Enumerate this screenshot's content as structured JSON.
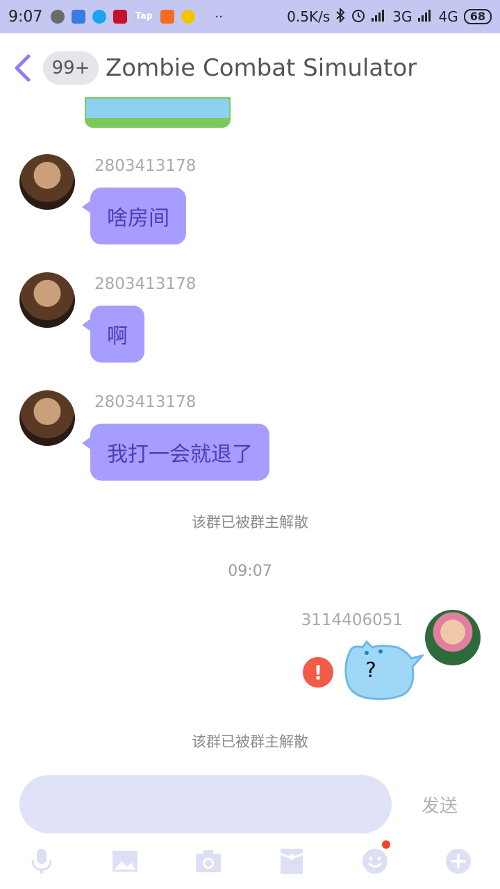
{
  "status_bar": {
    "time": "9:07",
    "net_speed": "0.5K/s",
    "signal1": "3G",
    "signal2": "4G",
    "battery": "68",
    "more_dots": "··"
  },
  "header": {
    "unread_badge": "99+",
    "title": "Zombie Combat Simulator"
  },
  "messages": [
    {
      "sender": "2803413178",
      "text": "啥房间"
    },
    {
      "sender": "2803413178",
      "text": "啊"
    },
    {
      "sender": "2803413178",
      "text": "我打一会就退了"
    }
  ],
  "system_notice_1": "该群已被群主解散",
  "timestamp": "09:07",
  "my_message": {
    "sender": "3114406051",
    "sticker_text": "?",
    "error_icon": "!"
  },
  "system_notice_2": "该群已被群主解散",
  "input": {
    "placeholder": "",
    "send_label": "发送"
  },
  "toolbar": [
    "voice-icon",
    "image-icon",
    "camera-icon",
    "red-packet-icon",
    "emoji-icon",
    "plus-icon"
  ],
  "colors": {
    "accent": "#8e7cff",
    "bubble_bg": "#a79cff",
    "bubble_text": "#4b3fb5",
    "status_bar_bg": "#c5c7f3",
    "input_bg": "#e0e3f8",
    "error_red": "#f15b47"
  }
}
